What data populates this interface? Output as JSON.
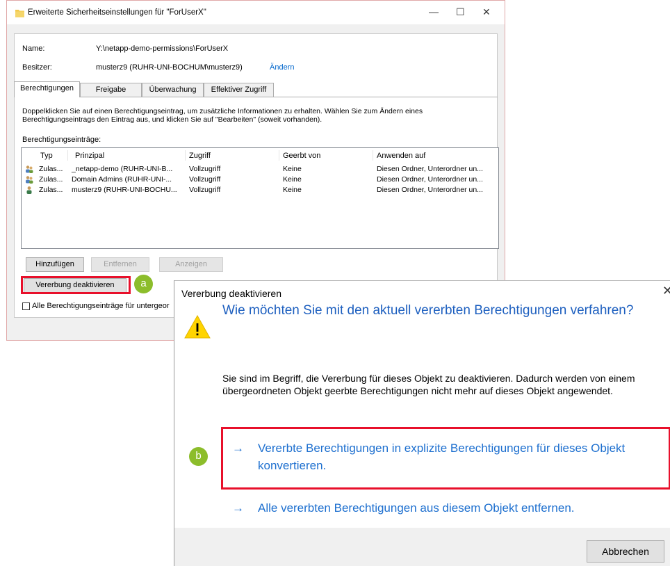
{
  "window": {
    "title": "Erweiterte Sicherheitseinstellungen für \"ForUserX\"",
    "minimize": "—",
    "maximize": "☐",
    "close": "✕"
  },
  "info": {
    "name_label": "Name:",
    "name_value": "Y:\\netapp-demo-permissions\\ForUserX",
    "owner_label": "Besitzer:",
    "owner_value": "musterz9 (RUHR-UNI-BOCHUM\\musterz9)",
    "change_link": "Ändern"
  },
  "tabs": [
    {
      "label": "Berechtigungen"
    },
    {
      "label": "Freigabe"
    },
    {
      "label": "Überwachung"
    },
    {
      "label": "Effektiver Zugriff"
    }
  ],
  "description": "Doppelklicken Sie auf einen Berechtigungseintrag, um zusätzliche Informationen zu erhalten. Wählen Sie zum Ändern eines Berechtigungseintrags den Eintrag aus, und klicken Sie auf \"Bearbeiten\" (soweit vorhanden).",
  "entries_label": "Berechtigungseinträge:",
  "table": {
    "headers": [
      "Typ",
      "Prinzipal",
      "Zugriff",
      "Geerbt von",
      "Anwenden auf"
    ],
    "rows": [
      {
        "typ": "Zulas...",
        "prinzipal": "_netapp-demo (RUHR-UNI-B...",
        "zugriff": "Vollzugriff",
        "geerbt": "Keine",
        "anwenden": "Diesen Ordner, Unterordner un..."
      },
      {
        "typ": "Zulas...",
        "prinzipal": "Domain Admins (RUHR-UNI-...",
        "zugriff": "Vollzugriff",
        "geerbt": "Keine",
        "anwenden": "Diesen Ordner, Unterordner un..."
      },
      {
        "typ": "Zulas...",
        "prinzipal": "musterz9 (RUHR-UNI-BOCHU...",
        "zugriff": "Vollzugriff",
        "geerbt": "Keine",
        "anwenden": "Diesen Ordner, Unterordner un..."
      }
    ]
  },
  "buttons": {
    "add": "Hinzufügen",
    "remove": "Entfernen",
    "view": "Anzeigen",
    "disable_inheritance": "Vererbung deaktivieren"
  },
  "checkbox_label": "Alle Berechtigungseinträge für untergeor",
  "badges": {
    "a": "a",
    "b": "b"
  },
  "dialog": {
    "title": "Vererbung deaktivieren",
    "close": "✕",
    "heading": "Wie möchten Sie mit den aktuell vererbten Berechtigungen verfahren?",
    "body": "Sie sind im Begriff, die Vererbung für dieses Objekt zu deaktivieren. Dadurch werden von einem übergeordneten Objekt geerbte Berechtigungen nicht mehr auf dieses Objekt angewendet.",
    "option1": "Vererbte Berechtigungen in explizite Berechtigungen für dieses Objekt konvertieren.",
    "option2": "Alle vererbten Berechtigungen aus diesem Objekt entfernen.",
    "arrow": "→",
    "cancel": "Abbrechen"
  },
  "colors": {
    "highlight_red": "#e8102b",
    "badge_green": "#8cbd2b",
    "link_blue": "#0066cc",
    "heading_blue": "#1d5fbf"
  }
}
